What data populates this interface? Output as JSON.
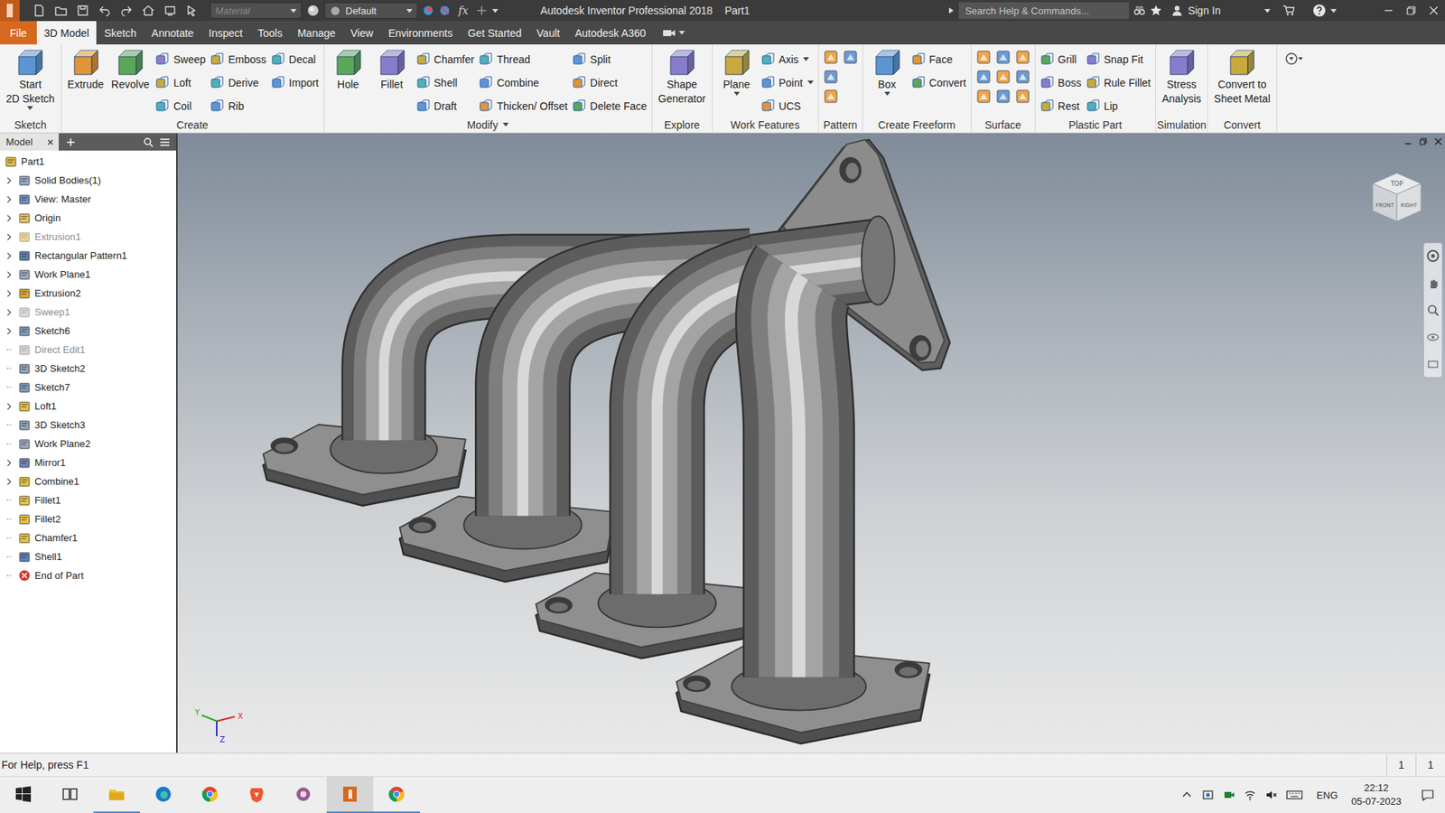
{
  "window": {
    "title": "Autodesk Inventor Professional 2018",
    "document": "Part1"
  },
  "quick_access": {
    "material": "Material",
    "appearance": "Default",
    "formula": "fx"
  },
  "search": {
    "placeholder": "Search Help & Commands..."
  },
  "account": {
    "sign_in": "Sign In"
  },
  "tabs": [
    {
      "label": "File",
      "selected": false,
      "kind": "file"
    },
    {
      "label": "3D Model",
      "selected": true,
      "kind": "tab"
    },
    {
      "label": "Sketch",
      "selected": false,
      "kind": "tab"
    },
    {
      "label": "Annotate",
      "selected": false,
      "kind": "tab"
    },
    {
      "label": "Inspect",
      "selected": false,
      "kind": "tab"
    },
    {
      "label": "Tools",
      "selected": false,
      "kind": "tab"
    },
    {
      "label": "Manage",
      "selected": false,
      "kind": "tab"
    },
    {
      "label": "View",
      "selected": false,
      "kind": "tab"
    },
    {
      "label": "Environments",
      "selected": false,
      "kind": "tab"
    },
    {
      "label": "Get Started",
      "selected": false,
      "kind": "tab"
    },
    {
      "label": "Vault",
      "selected": false,
      "kind": "tab"
    },
    {
      "label": "Autodesk A360",
      "selected": false,
      "kind": "tab"
    }
  ],
  "ribbon": {
    "panels": [
      {
        "label": "Sketch",
        "dropdown": false,
        "groups": [
          {
            "kind": "large",
            "lines": [
              "Start",
              "2D Sketch"
            ],
            "dropdown": true
          }
        ]
      },
      {
        "label": "Create",
        "dropdown": false,
        "groups": [
          {
            "kind": "large",
            "lines": [
              "Extrude"
            ],
            "dropdown": false
          },
          {
            "kind": "large",
            "lines": [
              "Revolve"
            ],
            "dropdown": false
          },
          {
            "kind": "stack",
            "items": [
              {
                "label": "Sweep",
                "dropdown": false
              },
              {
                "label": "Loft",
                "dropdown": false
              },
              {
                "label": "Coil",
                "dropdown": false
              }
            ]
          },
          {
            "kind": "stack",
            "items": [
              {
                "label": "Emboss",
                "dropdown": false
              },
              {
                "label": "Derive",
                "dropdown": false
              },
              {
                "label": "Rib",
                "dropdown": false
              }
            ]
          },
          {
            "kind": "stack",
            "items": [
              {
                "label": "Decal",
                "dropdown": false
              },
              {
                "label": "Import",
                "dropdown": false
              }
            ]
          }
        ]
      },
      {
        "label": "Modify",
        "dropdown": true,
        "groups": [
          {
            "kind": "large",
            "lines": [
              "Hole"
            ],
            "dropdown": false
          },
          {
            "kind": "large",
            "lines": [
              "Fillet"
            ],
            "dropdown": false
          },
          {
            "kind": "stack",
            "items": [
              {
                "label": "Chamfer",
                "dropdown": false
              },
              {
                "label": "Shell",
                "dropdown": false
              },
              {
                "label": "Draft",
                "dropdown": false
              }
            ]
          },
          {
            "kind": "stack",
            "items": [
              {
                "label": "Thread",
                "dropdown": false
              },
              {
                "label": "Combine",
                "dropdown": false
              },
              {
                "label": "Thicken/ Offset",
                "dropdown": false
              }
            ]
          },
          {
            "kind": "stack",
            "items": [
              {
                "label": "Split",
                "dropdown": false
              },
              {
                "label": "Direct",
                "dropdown": false
              },
              {
                "label": "Delete Face",
                "dropdown": false
              }
            ]
          }
        ]
      },
      {
        "label": "Explore",
        "dropdown": false,
        "groups": [
          {
            "kind": "large",
            "lines": [
              "Shape",
              "Generator"
            ],
            "dropdown": false
          }
        ]
      },
      {
        "label": "Work Features",
        "dropdown": false,
        "groups": [
          {
            "kind": "large",
            "lines": [
              "Plane"
            ],
            "dropdown": true
          },
          {
            "kind": "stack",
            "items": [
              {
                "label": "Axis",
                "dropdown": true
              },
              {
                "label": "Point",
                "dropdown": true
              },
              {
                "label": "UCS",
                "dropdown": false
              }
            ]
          }
        ]
      },
      {
        "label": "Pattern",
        "dropdown": false,
        "groups": [
          {
            "kind": "icons",
            "rows": [
              2,
              1,
              1
            ]
          }
        ]
      },
      {
        "label": "Create Freeform",
        "dropdown": false,
        "groups": [
          {
            "kind": "large",
            "lines": [
              "Box"
            ],
            "dropdown": true
          },
          {
            "kind": "stack",
            "items": [
              {
                "label": "Face",
                "dropdown": false
              },
              {
                "label": "Convert",
                "dropdown": false
              }
            ]
          }
        ]
      },
      {
        "label": "Surface",
        "dropdown": false,
        "groups": [
          {
            "kind": "icons",
            "rows": [
              3,
              3,
              3
            ]
          }
        ]
      },
      {
        "label": "Plastic Part",
        "dropdown": false,
        "groups": [
          {
            "kind": "stack",
            "items": [
              {
                "label": "Grill",
                "dropdown": false
              },
              {
                "label": "Boss",
                "dropdown": false
              },
              {
                "label": "Rest",
                "dropdown": false
              }
            ]
          },
          {
            "kind": "stack",
            "items": [
              {
                "label": "Snap Fit",
                "dropdown": false
              },
              {
                "label": "Rule Fillet",
                "dropdown": false
              },
              {
                "label": "Lip",
                "dropdown": false
              }
            ]
          }
        ]
      },
      {
        "label": "Simulation",
        "dropdown": false,
        "groups": [
          {
            "kind": "large",
            "lines": [
              "Stress",
              "Analysis"
            ],
            "dropdown": false
          }
        ]
      },
      {
        "label": "Convert",
        "dropdown": false,
        "groups": [
          {
            "kind": "large",
            "lines": [
              "Convert to",
              "Sheet Metal"
            ],
            "dropdown": false
          }
        ]
      }
    ]
  },
  "browser": {
    "tab": "Model",
    "items": [
      {
        "label": "Part1",
        "depth": 0,
        "expandable": false,
        "suppressed": false,
        "kind": "part"
      },
      {
        "label": "Solid Bodies(1)",
        "depth": 1,
        "expandable": true,
        "suppressed": false,
        "kind": "bodies"
      },
      {
        "label": "View: Master",
        "depth": 1,
        "expandable": true,
        "suppressed": false,
        "kind": "view"
      },
      {
        "label": "Origin",
        "depth": 1,
        "expandable": true,
        "suppressed": false,
        "kind": "origin"
      },
      {
        "label": "Extrusion1",
        "depth": 1,
        "expandable": true,
        "suppressed": true,
        "kind": "extrude"
      },
      {
        "label": "Rectangular Pattern1",
        "depth": 1,
        "expandable": true,
        "suppressed": false,
        "kind": "pattern"
      },
      {
        "label": "Work Plane1",
        "depth": 1,
        "expandable": true,
        "suppressed": false,
        "kind": "plane"
      },
      {
        "label": "Extrusion2",
        "depth": 1,
        "expandable": true,
        "suppressed": false,
        "kind": "extrude"
      },
      {
        "label": "Sweep1",
        "depth": 1,
        "expandable": true,
        "suppressed": true,
        "kind": "sweep"
      },
      {
        "label": "Sketch6",
        "depth": 1,
        "expandable": true,
        "suppressed": false,
        "kind": "sketch"
      },
      {
        "label": "Direct Edit1",
        "depth": 1,
        "expandable": false,
        "suppressed": true,
        "kind": "direct"
      },
      {
        "label": "3D Sketch2",
        "depth": 1,
        "expandable": false,
        "suppressed": false,
        "kind": "sketch3d"
      },
      {
        "label": "Sketch7",
        "depth": 1,
        "expandable": false,
        "suppressed": false,
        "kind": "sketch"
      },
      {
        "label": "Loft1",
        "depth": 1,
        "expandable": true,
        "suppressed": false,
        "kind": "loft"
      },
      {
        "label": "3D Sketch3",
        "depth": 1,
        "expandable": false,
        "suppressed": false,
        "kind": "sketch3d"
      },
      {
        "label": "Work Plane2",
        "depth": 1,
        "expandable": false,
        "suppressed": false,
        "kind": "plane"
      },
      {
        "label": "Mirror1",
        "depth": 1,
        "expandable": true,
        "suppressed": false,
        "kind": "mirror"
      },
      {
        "label": "Combine1",
        "depth": 1,
        "expandable": true,
        "suppressed": false,
        "kind": "combine"
      },
      {
        "label": "Fillet1",
        "depth": 1,
        "expandable": false,
        "suppressed": false,
        "kind": "fillet"
      },
      {
        "label": "Fillet2",
        "depth": 1,
        "expandable": false,
        "suppressed": false,
        "kind": "fillet"
      },
      {
        "label": "Chamfer1",
        "depth": 1,
        "expandable": false,
        "suppressed": false,
        "kind": "chamfer"
      },
      {
        "label": "Shell1",
        "depth": 1,
        "expandable": false,
        "suppressed": false,
        "kind": "shell"
      },
      {
        "label": "End of Part",
        "depth": 1,
        "expandable": false,
        "suppressed": false,
        "kind": "end"
      }
    ]
  },
  "viewport": {
    "viewcube": [
      "TOP",
      "FRONT",
      "RIGHT"
    ],
    "axes": [
      "X",
      "Y",
      "Z"
    ]
  },
  "status_bar": {
    "help": "For Help, press F1",
    "counters": [
      "1",
      "1"
    ]
  },
  "taskbar": {
    "apps": [
      {
        "kind": "taskview",
        "running": false,
        "selected": false
      },
      {
        "kind": "explorer",
        "running": true,
        "selected": false
      },
      {
        "kind": "edge",
        "running": false,
        "selected": false
      },
      {
        "kind": "chrome",
        "running": false,
        "selected": false
      },
      {
        "kind": "brave",
        "running": false,
        "selected": false
      },
      {
        "kind": "tool",
        "running": false,
        "selected": false
      },
      {
        "kind": "inventor",
        "running": true,
        "selected": true
      },
      {
        "kind": "chrome",
        "running": true,
        "selected": false
      }
    ],
    "language": "ENG",
    "time": "22:12",
    "date": "05-07-2023"
  }
}
